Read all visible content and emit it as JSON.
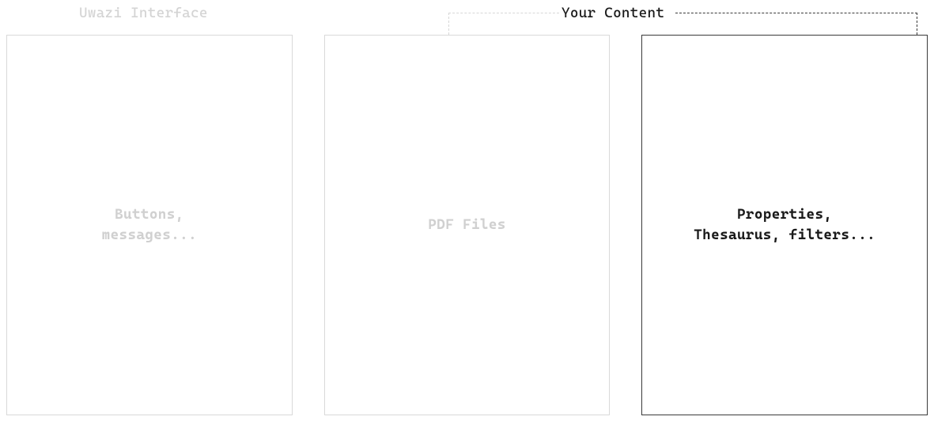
{
  "headers": {
    "left": "Uwazi Interface",
    "right": "Your Content"
  },
  "boxes": {
    "left": {
      "line1": "Buttons,",
      "line2": "messages..."
    },
    "middle": {
      "line1": "PDF Files"
    },
    "right": {
      "line1": "Properties,",
      "line2": "Thesaurus, filters..."
    }
  }
}
